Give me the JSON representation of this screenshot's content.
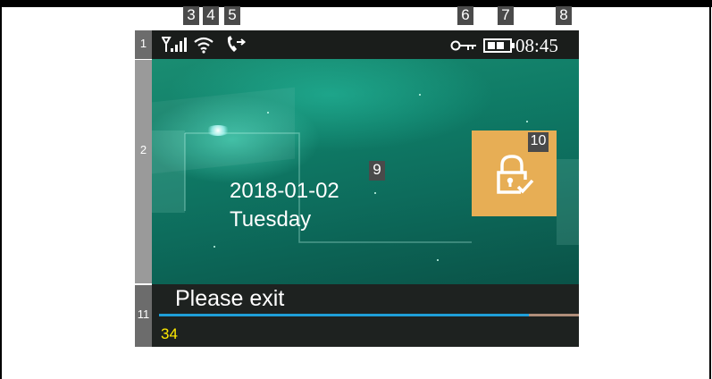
{
  "callouts": {
    "c1": "1",
    "c2": "2",
    "c3": "3",
    "c4": "4",
    "c5": "5",
    "c6": "6",
    "c7": "7",
    "c8": "8",
    "c9": "9",
    "c10": "10",
    "c11": "11"
  },
  "status_bar": {
    "time": "08:45",
    "icons": [
      "signal-icon",
      "wifi-icon",
      "call-forward-icon",
      "key-icon",
      "battery-icon"
    ]
  },
  "main_screen": {
    "date": "2018-01-02",
    "day": "Tuesday",
    "lock_icon": "lock-check-icon",
    "lock_tile_color": "#e7ae55"
  },
  "bottom": {
    "message": "Please exit",
    "countdown": "34",
    "progress": 0.88,
    "countdown_color": "#ffea00"
  }
}
